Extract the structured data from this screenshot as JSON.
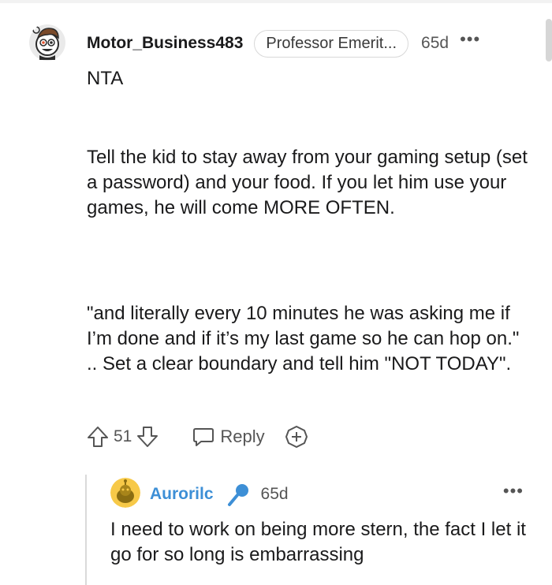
{
  "comment": {
    "username": "Motor_Business483",
    "flair": "Professor Emerit...",
    "age": "65d",
    "more": "•••",
    "paragraphs": [
      "NTA",
      "Tell the kid to stay away from your gaming setup (set a password) and your food. If you let him use your games, he will come MORE OFTEN.",
      "\"and literally every 10 minutes he was asking me if I’m done and if it’s my last game so he can hop on.\" .. Set a clear boundary and tell him \"NOT TODAY\"."
    ],
    "actions": {
      "upvote_icon": "upvote-arrow-icon",
      "vote_count": "51",
      "downvote_icon": "downvote-arrow-icon",
      "reply_icon": "speech-bubble-icon",
      "reply_label": "Reply",
      "award_icon": "plus-circle-award-icon"
    }
  },
  "reply": {
    "username": "Aurorilc",
    "flair_icon": "microphone-icon",
    "age": "65d",
    "more": "•••",
    "text": "I need to work on being more stern, the fact I let it go for so long is embarrassing"
  },
  "colors": {
    "reply_username": "#3d8fd6",
    "reply_avatar_bg": "#f7c948",
    "mic_icon": "#3d8fd6"
  }
}
